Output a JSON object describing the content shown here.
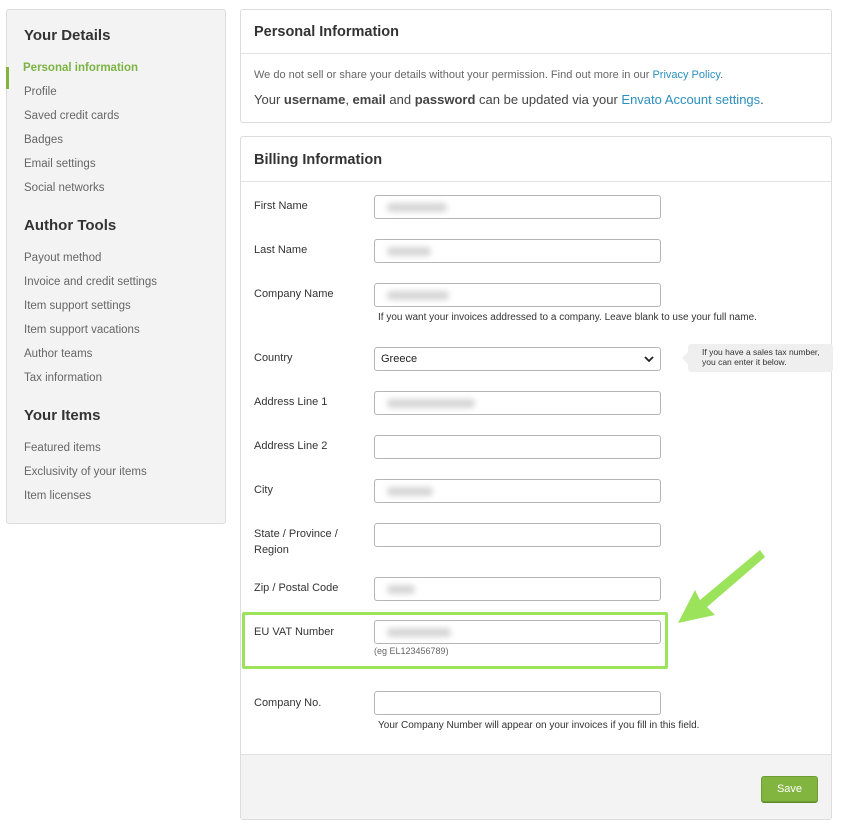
{
  "sidebar": {
    "sections": [
      {
        "heading": "Your Details",
        "items": [
          "Personal information",
          "Profile",
          "Saved credit cards",
          "Badges",
          "Email settings",
          "Social networks"
        ]
      },
      {
        "heading": "Author Tools",
        "items": [
          "Payout method",
          "Invoice and credit settings",
          "Item support settings",
          "Item support vacations",
          "Author teams",
          "Tax information"
        ]
      },
      {
        "heading": "Your Items",
        "items": [
          "Featured items",
          "Exclusivity of your items",
          "Item licenses"
        ]
      }
    ],
    "active_item": "Personal information"
  },
  "personal_info": {
    "title": "Personal Information",
    "line1_text": "We do not sell or share your details without your permission. Find out more in our ",
    "line1_link": "Privacy Policy",
    "line1_end": ".",
    "line2_a": "Your ",
    "line2_username": "username",
    "line2_b": ", ",
    "line2_email": "email",
    "line2_c": " and ",
    "line2_password": "password",
    "line2_d": " can be updated via your ",
    "line2_link": "Envato Account settings",
    "line2_end": "."
  },
  "billing": {
    "title": "Billing Information",
    "fields": {
      "first_name": {
        "label": "First Name",
        "value": ""
      },
      "last_name": {
        "label": "Last Name",
        "value": ""
      },
      "company_name": {
        "label": "Company Name",
        "value": "",
        "help": "If you want your invoices addressed to a company. Leave blank to use your full name."
      },
      "country": {
        "label": "Country",
        "value": "Greece"
      },
      "address1": {
        "label": "Address Line 1",
        "value": ""
      },
      "address2": {
        "label": "Address Line 2",
        "value": ""
      },
      "city": {
        "label": "City",
        "value": ""
      },
      "state": {
        "label_line1": "State / Province /",
        "label_line2": "Region",
        "value": ""
      },
      "zip": {
        "label": "Zip / Postal Code",
        "value": ""
      },
      "vat": {
        "label": "EU VAT Number",
        "value": "",
        "hint": "(eg EL123456789)"
      },
      "company_no": {
        "label": "Company No.",
        "value": "",
        "help": "Your Company Number will appear on your invoices if you fill in this field."
      }
    },
    "tooltip_line1": "If you have a sales tax number,",
    "tooltip_line2": "you can enter it below.",
    "save_label": "Save"
  },
  "colors": {
    "accent_green": "#82b440",
    "link_blue": "#2a8fbd",
    "highlight_green": "#9be35b"
  }
}
